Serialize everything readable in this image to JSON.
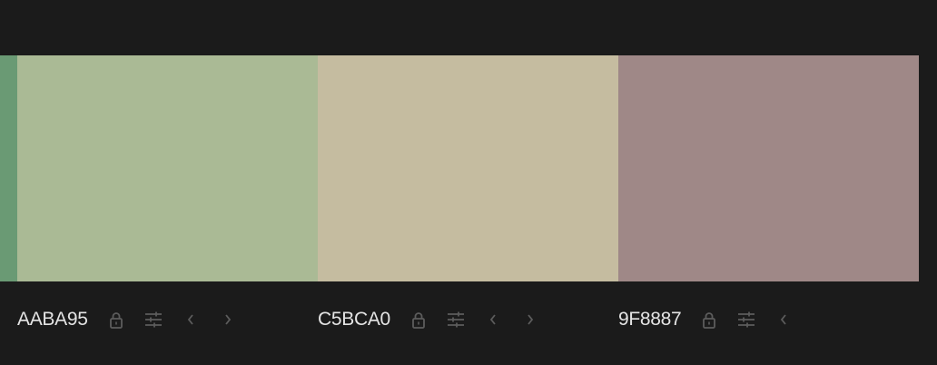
{
  "palette": {
    "edge_color": "#6a9a74",
    "swatches": [
      {
        "hex": "AABA95",
        "color": "#aaba95",
        "has_next": true
      },
      {
        "hex": "C5BCA0",
        "color": "#c5bca0",
        "has_next": true
      },
      {
        "hex": "9F8887",
        "color": "#9f8887",
        "has_next": false
      }
    ],
    "icons": [
      "lock-icon",
      "sliders-icon",
      "chevron-left-icon",
      "chevron-right-icon"
    ],
    "icon_color": "#5c5c5c"
  }
}
